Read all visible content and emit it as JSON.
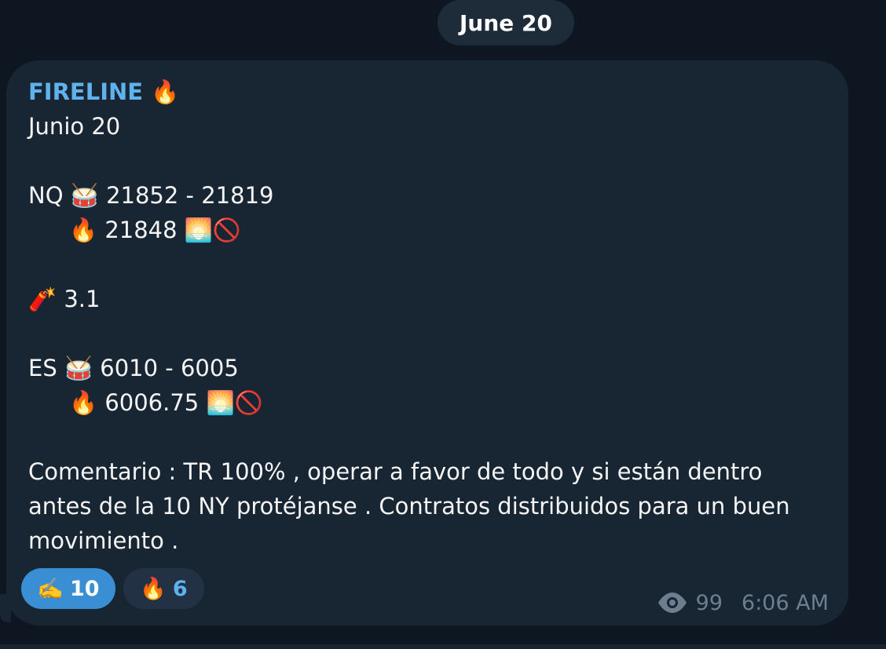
{
  "date_separator": "June 20",
  "message": {
    "sender": "FIRELINE 🔥",
    "lines": {
      "l1": "Junio 20",
      "l2": "NQ 🥁  21852 - 21819",
      "l3": "🔥 21848 🌅🚫",
      "l4": "🧨 3.1",
      "l5": "ES 🥁  6010 - 6005",
      "l6": "🔥 6006.75 🌅🚫",
      "l7": "Comentario : TR 100% , operar a favor de todo y si están dentro",
      "l8": "antes de la 10 NY protéjanse . Contratos distribuidos para un buen",
      "l9": "movimiento ."
    },
    "reactions": [
      {
        "emoji": "✍️",
        "count": "10",
        "selected": true
      },
      {
        "emoji": "🔥",
        "count": "6",
        "selected": false
      }
    ],
    "views": "99",
    "time": "6:06 AM"
  },
  "colors": {
    "background": "#0e1621",
    "bubble": "#182533",
    "sender": "#5fb2ec",
    "reaction_selected": "#3a8fd4"
  }
}
